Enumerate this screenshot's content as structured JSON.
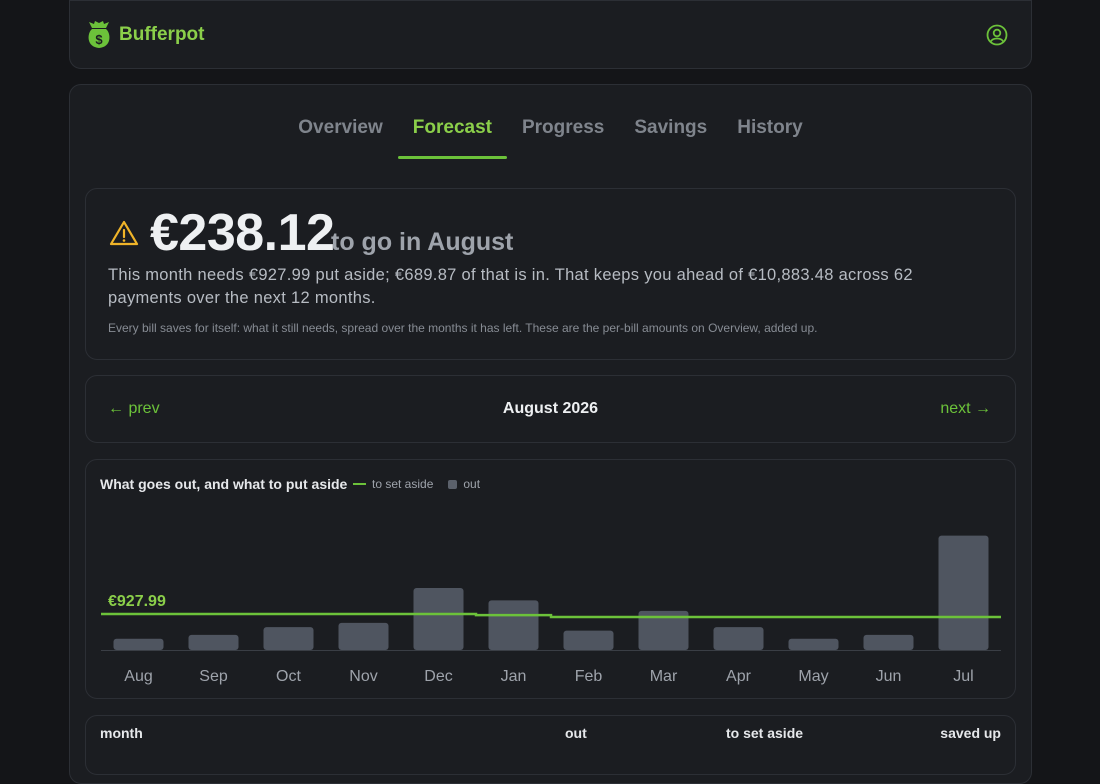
{
  "app": {
    "name": "Bufferpot",
    "logo_icon": "money-bag-icon",
    "account_icon": "user-circle-icon"
  },
  "tabs": [
    {
      "label": "Overview",
      "active": false
    },
    {
      "label": "Forecast",
      "active": true
    },
    {
      "label": "Progress",
      "active": false
    },
    {
      "label": "Savings",
      "active": false
    },
    {
      "label": "History",
      "active": false
    }
  ],
  "summary": {
    "icon": "warning-icon",
    "amount": "€238.12",
    "amount_suffix": "to go in August",
    "line": "This month needs €927.99 put aside; €689.87 of that is in. That keeps you ahead of €10,883.48 across 62 payments over the next 12 months.",
    "note": "Every bill saves for itself: what it still needs, spread over the months it has left. These are the per-bill amounts on Overview, added up."
  },
  "month_nav": {
    "prev": "← prev",
    "current": "August 2026",
    "next": "next →"
  },
  "chart": {
    "title": "What goes out, and what to put aside",
    "legend_line": "to set aside",
    "legend_bar": "out",
    "highlight_label": "€927.99"
  },
  "chart_data": {
    "type": "bar",
    "categories": [
      "Aug",
      "Sep",
      "Oct",
      "Nov",
      "Dec",
      "Jan",
      "Feb",
      "Mar",
      "Apr",
      "May",
      "Jun",
      "Jul"
    ],
    "series": [
      {
        "name": "out",
        "type": "bar",
        "values": [
          290,
          390,
          590,
          700,
          1600,
          1280,
          500,
          1010,
          590,
          290,
          390,
          2950
        ]
      },
      {
        "name": "to set aside",
        "type": "line",
        "values": [
          927.99,
          927.99,
          927.99,
          927.99,
          927.99,
          900,
          850,
          850,
          850,
          850,
          850,
          850
        ]
      }
    ],
    "ylim": [
      0,
      3300
    ],
    "colors": {
      "bar": "#4f5560",
      "line": "#6cc23a"
    }
  },
  "table": {
    "headers": [
      "month",
      "out",
      "to set aside",
      "saved up"
    ]
  },
  "colors": {
    "accent": "#8bcf4a",
    "accent_line": "#6cc23a",
    "warning": "#f0b429"
  }
}
